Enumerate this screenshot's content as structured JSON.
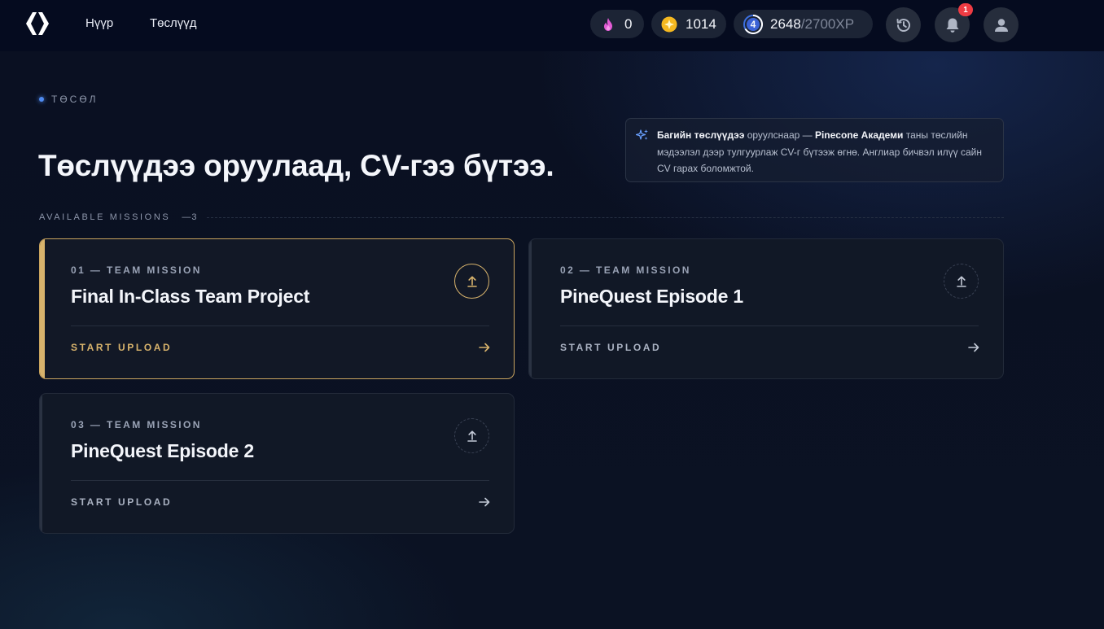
{
  "nav": {
    "logo": "brand-logo",
    "links": [
      "Нүүр",
      "Төслүүд"
    ]
  },
  "stats": {
    "streak": "0",
    "coins": "1014",
    "level": "4",
    "xp": "2648",
    "xp_max": "/2700XP"
  },
  "notifications": {
    "count": "1"
  },
  "header": {
    "eyebrow": "ТӨСӨЛ",
    "title": "Төслүүдээ оруулаад, CV-гээ бүтээ."
  },
  "info": {
    "bold1": "Багийн төслүүдээ",
    "text1": " оруулснаар — ",
    "bold2": "Pinecone Академи",
    "text2": " таны төслийн мэдээлэл дээр тулгуурлаж CV-г бүтээж өгнө. Англиар бичвэл илүү сайн CV гарах боломжтой."
  },
  "missions_header": {
    "label": "AVAILABLE MISSIONS",
    "count": "—3"
  },
  "missions": [
    {
      "label": "01 — TEAM MISSION",
      "title": "Final In-Class Team Project",
      "action": "START UPLOAD"
    },
    {
      "label": "02 — TEAM MISSION",
      "title": "PineQuest Episode 1",
      "action": "START UPLOAD"
    },
    {
      "label": "03 — TEAM MISSION",
      "title": "PineQuest Episode 2",
      "action": "START UPLOAD"
    }
  ],
  "colors": {
    "accent_gold": "#d8b36c",
    "accent_blue": "#4f8bf0",
    "badge_red": "#ef3b43",
    "coin_yellow": "#f5b820",
    "flame_pink": "#e35bd6"
  },
  "icons": [
    "flame-icon",
    "coin-icon",
    "level-icon",
    "history-icon",
    "bell-icon",
    "user-icon",
    "sparkle-icon",
    "upload-icon",
    "arrow-right-icon"
  ]
}
